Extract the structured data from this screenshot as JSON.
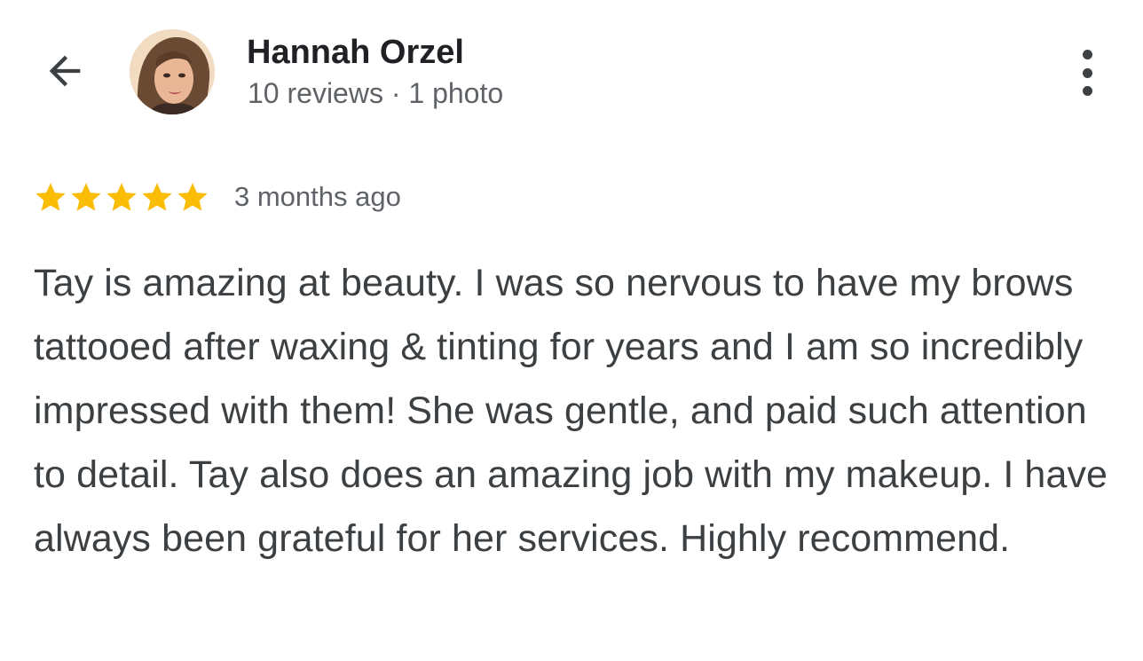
{
  "header": {
    "back_icon": "arrow-back-icon",
    "reviewer_name": "Hannah Orzel",
    "reviewer_meta": "10 reviews · 1 photo",
    "more_icon": "more-vert-icon"
  },
  "review": {
    "rating": 5,
    "rating_max": 5,
    "star_color": "#fbbc04",
    "time_ago": "3 months ago",
    "text": "Tay is amazing at beauty. I was so nervous to have my brows tattooed after waxing & tinting for years and I am so incredibly impressed with them! She was gentle, and paid such attention to detail. Tay also does an amazing job with my makeup. I have always been grateful for her services. Highly recommend."
  }
}
